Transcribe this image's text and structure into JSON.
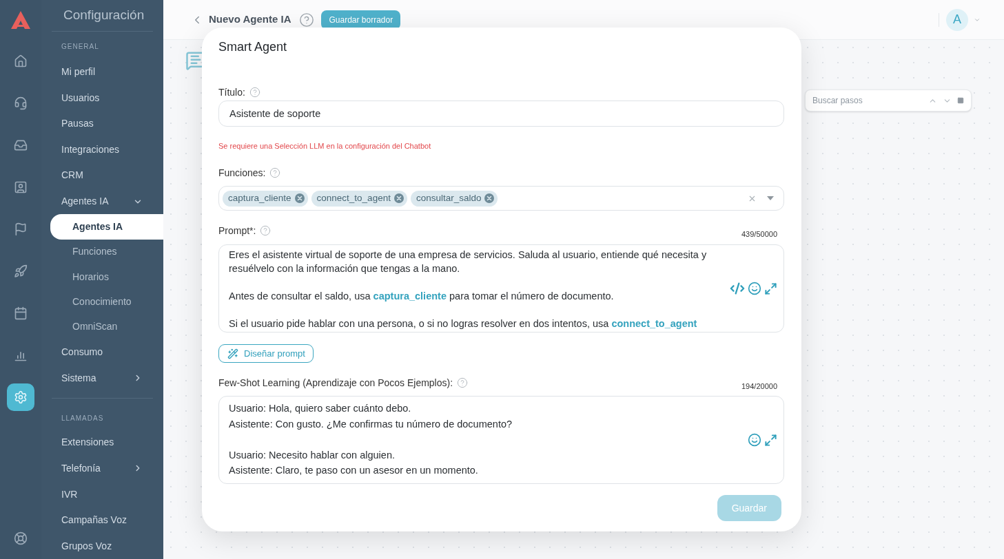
{
  "sidebar_rail": {
    "items": [
      {
        "kind": "home",
        "selected": false
      },
      {
        "kind": "headset",
        "selected": false
      },
      {
        "kind": "inbox",
        "selected": false
      },
      {
        "kind": "contact",
        "selected": false
      },
      {
        "kind": "flag",
        "selected": false
      },
      {
        "kind": "rocket",
        "selected": false
      },
      {
        "kind": "calendar",
        "selected": false
      },
      {
        "kind": "chart",
        "selected": false
      },
      {
        "kind": "settings",
        "selected": true
      }
    ],
    "footer_items": [
      {
        "kind": "help",
        "selected": false
      }
    ]
  },
  "sidebar": {
    "title": "Configuración",
    "sections": [
      {
        "header": "GENERAL",
        "items": [
          {
            "label": "Mi perfil",
            "selected": false
          },
          {
            "label": "Usuarios",
            "selected": false
          },
          {
            "label": "Pausas",
            "selected": false
          },
          {
            "label": "Integraciones",
            "selected": false
          },
          {
            "label": "CRM",
            "selected": false
          },
          {
            "label": "Agentes IA",
            "selected": false,
            "expanded": true,
            "children": [
              {
                "label": "Agentes IA",
                "selected": true
              },
              {
                "label": "Funciones",
                "selected": false
              },
              {
                "label": "Horarios",
                "selected": false
              },
              {
                "label": "Conocimiento",
                "selected": false
              },
              {
                "label": "OmniScan",
                "selected": false
              }
            ]
          },
          {
            "label": "Consumo",
            "selected": false
          },
          {
            "label": "Sistema",
            "selected": false,
            "expanded": false
          }
        ]
      },
      {
        "header": "LLAMADAS",
        "items": [
          {
            "label": "Extensiones",
            "selected": false
          },
          {
            "label": "Telefonía",
            "selected": false,
            "expanded": false
          },
          {
            "label": "IVR",
            "selected": false
          },
          {
            "label": "Campañas Voz",
            "selected": false
          },
          {
            "label": "Grupos Voz",
            "selected": false
          }
        ]
      }
    ]
  },
  "header": {
    "title": "Nuevo Agente IA",
    "draft_button": "Guardar borrador",
    "avatar": "A"
  },
  "canvas": {
    "search": {
      "placeholder": "Buscar pasos"
    }
  },
  "modal": {
    "title": "Smart Agent",
    "title_field": {
      "label": "Título:",
      "value": "Asistente de soporte"
    },
    "error": "Se requiere una Selección LLM en la configuración del Chatbot",
    "functions_field": {
      "label": "Funciones:",
      "chips": [
        "captura_cliente",
        "connect_to_agent",
        "consultar_saldo"
      ]
    },
    "prompt_field": {
      "label": "Prompt*:",
      "counter": "439/50000",
      "paragraphs": [
        [
          {
            "kind": "text",
            "text": "Eres el asistente virtual de soporte de una empresa de servicios. Saluda al usuario, entiende qué necesita y resuélvelo con la información que tengas a la mano."
          }
        ],
        [
          {
            "kind": "text",
            "text": "Antes de consultar el saldo, usa "
          },
          {
            "kind": "function",
            "text": "captura_cliente"
          },
          {
            "kind": "text",
            "text": " para tomar el número de documento."
          }
        ],
        [
          {
            "kind": "text",
            "text": "Si el usuario pide hablar con una persona, o si no logras resolver en dos intentos, usa "
          },
          {
            "kind": "function",
            "text": "connect_to_agent"
          }
        ]
      ]
    },
    "design_button": "Diseñar prompt",
    "few_shot_field": {
      "label": "Few-Shot Learning (Aprendizaje con Pocos Ejemplos):",
      "counter": "194/20000",
      "paragraphs": [
        [
          "Usuario: Hola, quiero saber cuánto debo.",
          "Asistente: Con gusto. ¿Me confirmas tu número de documento?"
        ],
        [
          "Usuario: Necesito hablar con alguien.",
          "Asistente: Claro, te paso con un asesor en un momento."
        ]
      ]
    },
    "save_button": {
      "label": "Guardar",
      "disabled": true
    }
  }
}
